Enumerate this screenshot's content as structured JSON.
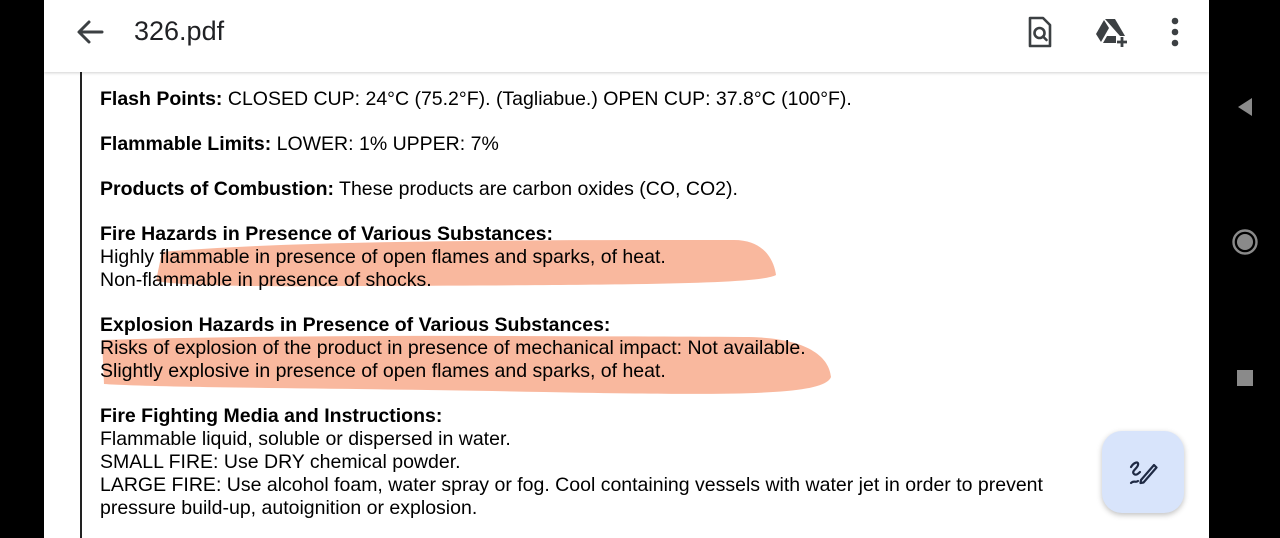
{
  "header": {
    "title": "326.pdf",
    "icons": [
      "back-arrow-icon",
      "search-in-document-icon",
      "add-to-drive-icon",
      "more-options-icon"
    ]
  },
  "document": {
    "flash_points": {
      "label": "Flash Points:",
      "text": " CLOSED CUP: 24°C (75.2°F). (Tagliabue.) OPEN CUP: 37.8°C (100°F)."
    },
    "flammable_limits": {
      "label": "Flammable Limits:",
      "text": " LOWER: 1% UPPER: 7%"
    },
    "combustion": {
      "label": "Products of Combustion:",
      "text": " These products are carbon oxides (CO, CO2)."
    },
    "fire_hazards": {
      "heading": "Fire Hazards in Presence of Various Substances:",
      "lines": [
        "Highly flammable in presence of open flames and sparks, of heat.",
        "Non-flammable in presence of shocks."
      ]
    },
    "explosion_hazards": {
      "heading": "Explosion Hazards in Presence of Various Substances:",
      "lines": [
        "Risks of explosion of the product in presence of mechanical impact: Not available.",
        "Slightly explosive in presence of open flames and sparks, of heat."
      ]
    },
    "fire_fighting": {
      "heading": "Fire Fighting Media and Instructions:",
      "lines": [
        "Flammable liquid, soluble or dispersed in water.",
        "SMALL FIRE: Use DRY chemical powder.",
        "LARGE FIRE: Use alcohol foam, water spray or fog. Cool containing vessels with water jet in order to prevent",
        "pressure build-up, autoignition or explosion."
      ]
    }
  },
  "annotations": {
    "highlight_color": "#f7a07e"
  },
  "fab": {
    "icon": "annotate-pen-icon",
    "color": "#d8e4fb"
  },
  "system_nav": {
    "icons": [
      "nav-back-icon",
      "nav-home-icon",
      "nav-recents-icon"
    ]
  }
}
